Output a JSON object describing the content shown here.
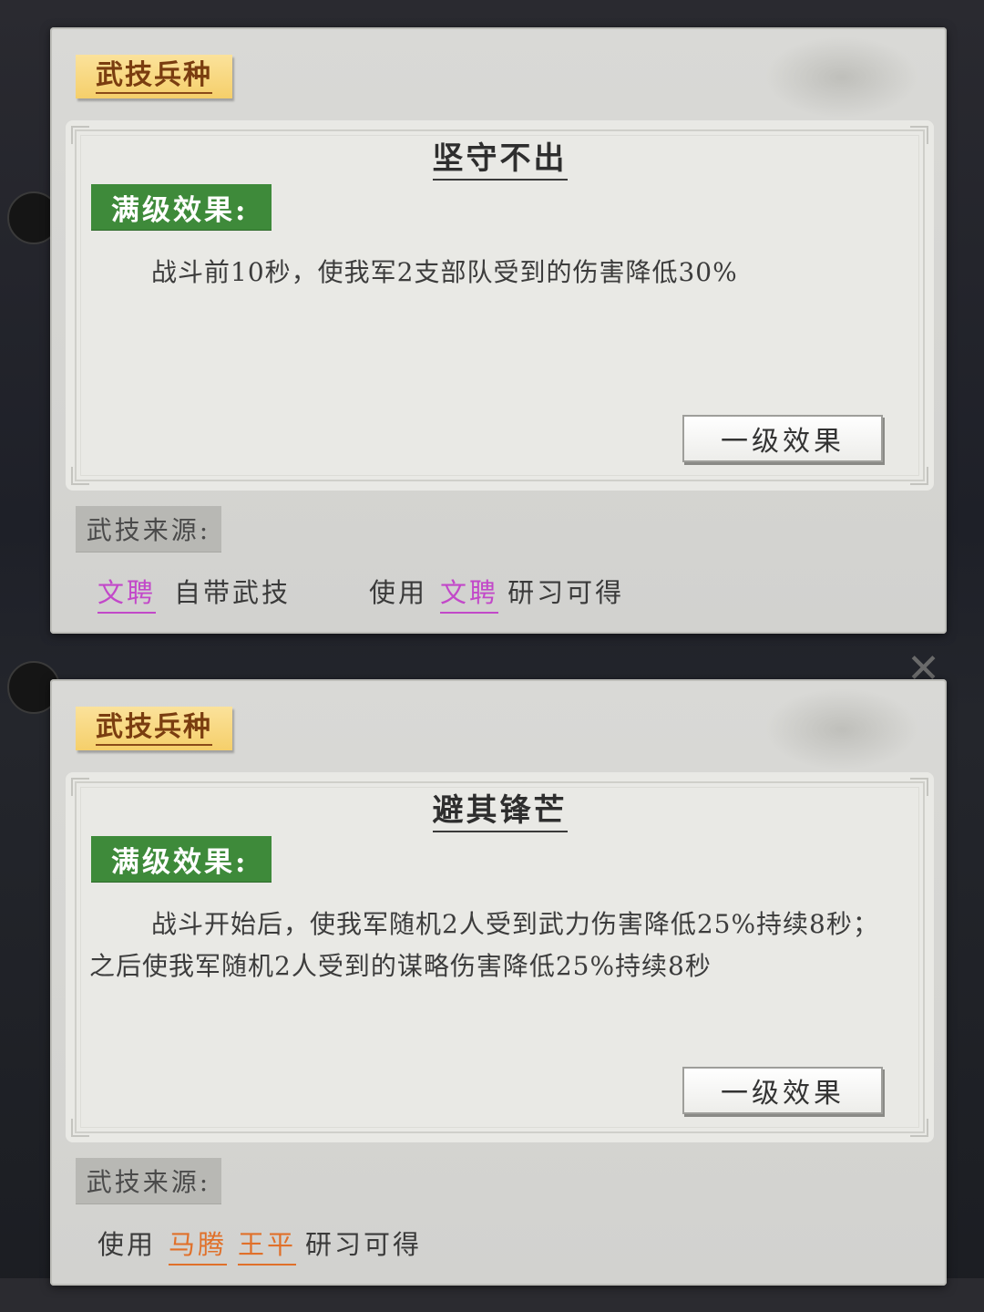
{
  "colors": {
    "tag_yellow": "#f5cf6a",
    "tag_green": "#3e8a3a",
    "tag_grey": "#b8b8b4",
    "hero_purple": "#c248c9",
    "hero_orange": "#e0702a"
  },
  "cards": [
    {
      "category_tag": "武技兵种",
      "skill_name": "坚守不出",
      "max_level_label": "满级效果:",
      "effect_text": "战斗前10秒，使我军2支部队受到的伤害降低30%",
      "level_button": "一级效果",
      "source_label": "武技来源:",
      "source": {
        "hero1": "文聘",
        "text1": "自带武技",
        "text2": "使用",
        "hero2": "文聘",
        "text3": "研习可得"
      }
    },
    {
      "category_tag": "武技兵种",
      "skill_name": "避其锋芒",
      "max_level_label": "满级效果:",
      "effect_text": "战斗开始后，使我军随机2人受到武力伤害降低25%持续8秒；之后使我军随机2人受到的谋略伤害降低25%持续8秒",
      "level_button": "一级效果",
      "source_label": "武技来源:",
      "source": {
        "text1": "使用",
        "hero1": "马腾",
        "hero2": "王平",
        "text2": "研习可得"
      }
    }
  ]
}
